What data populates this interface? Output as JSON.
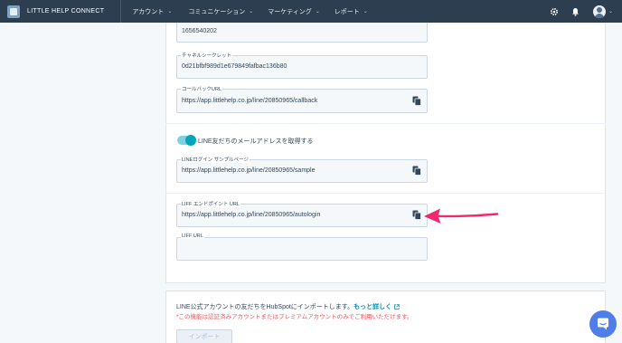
{
  "nav": {
    "brand": "LITTLE HELP CONNECT",
    "items": [
      {
        "label": "アカウント"
      },
      {
        "label": "コミュニケーション"
      },
      {
        "label": "マーケティング"
      },
      {
        "label": "レポート"
      }
    ],
    "icons": [
      "gear-icon",
      "bell-icon",
      "avatar"
    ]
  },
  "settings": {
    "channel_id": {
      "value": "1656540202"
    },
    "channel_secret": {
      "label": "チャネルシークレット",
      "value": "0d21bfbf989d1e679849fafbac136b80"
    },
    "callback_url": {
      "label": "コールバックURL",
      "value": "https://app.littlehelp.co.jp/line/20850965/callback"
    },
    "email_toggle": {
      "label": "LINE友だちのメールアドレスを取得する",
      "on": true
    },
    "login_sample": {
      "label": "LINEログイン サンプルページ",
      "value": "https://app.littlehelp.co.jp/line/20850965/sample"
    },
    "liff_endpoint": {
      "label": "LIFF エンドポイント URL",
      "value": "https://app.littlehelp.co.jp/line/20850965/autologin"
    },
    "liff_url": {
      "label": "LIFF URL",
      "value": ""
    }
  },
  "import_section": {
    "text": "LINE公式アカウントの友だちをHubSpotにインポートします。",
    "learn_more": "もっと詳しく",
    "warning": "*この機能は認証済みアカウントまたはプレミアムアカウントのみでご利用いただけます。",
    "button": "インポート"
  },
  "colors": {
    "topbar": "#2d3e50",
    "toggle": "#00a4bd",
    "link": "#0091ae",
    "warning": "#f2545b",
    "annotation_arrow": "#f2286d",
    "chat": "#4f7ee8"
  }
}
